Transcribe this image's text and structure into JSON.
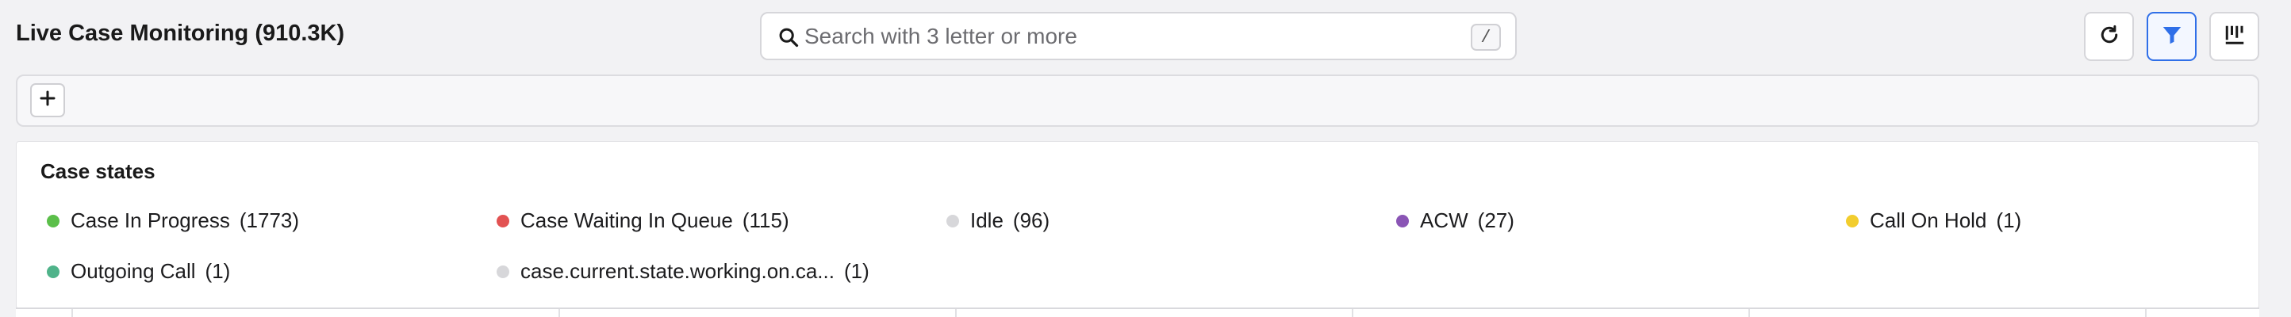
{
  "header": {
    "title": "Live Case Monitoring (910.3K)"
  },
  "search": {
    "placeholder": "Search with 3 letter or more",
    "value": "",
    "shortcut": "/",
    "icon": "search-icon"
  },
  "toolbar": {
    "refresh_icon": "refresh-icon",
    "filter_icon": "filter-icon",
    "columns_icon": "column-settings-icon",
    "filter_active": true,
    "accent_color": "#2f6fe8"
  },
  "filter_bar": {
    "add_label": "+"
  },
  "case_states": {
    "title": "Case states",
    "items": [
      {
        "label": "Case In Progress",
        "count": "(1773)",
        "color": "#5bbf4a"
      },
      {
        "label": "Case Waiting In Queue",
        "count": "(115)",
        "color": "#e25252"
      },
      {
        "label": "Idle",
        "count": "(96)",
        "color": "#d7d7da"
      },
      {
        "label": "ACW",
        "count": "(27)",
        "color": "#8a55b5"
      },
      {
        "label": "Call On Hold",
        "count": "(1)",
        "color": "#f2cd2e"
      },
      {
        "label": "Outgoing Call",
        "count": "(1)",
        "color": "#4fb38a"
      },
      {
        "label": "case.current.state.working.on.ca...",
        "count": "(1)",
        "color": "#d7d7da"
      }
    ]
  }
}
